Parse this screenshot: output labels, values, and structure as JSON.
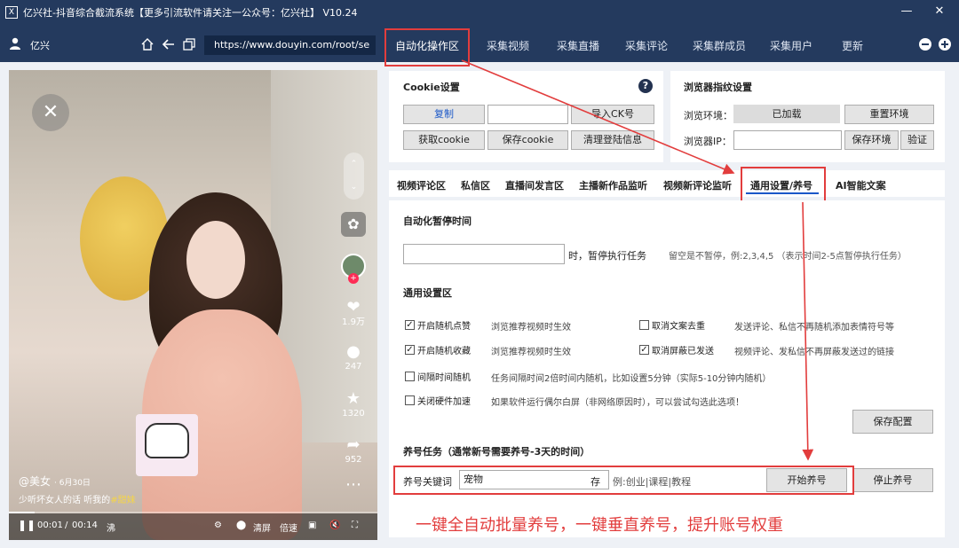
{
  "window": {
    "title": "亿兴社-抖音综合截流系统【更多引流软件请关注一公众号：亿兴社】 V10.24",
    "logo": "X",
    "min_icon": "minimize-icon",
    "close_icon": "close-icon"
  },
  "nav": {
    "username": "亿兴",
    "url": "https://www.douyin.com/root/se",
    "tabs": [
      "自动化操作区",
      "采集视频",
      "采集直播",
      "采集评论",
      "采集群成员",
      "采集用户",
      "更新"
    ],
    "active_tab": "自动化操作区"
  },
  "video": {
    "like_count": "1.9万",
    "comment_count": "247",
    "favorite_count": "1320",
    "share_count": "952",
    "author": "@美女",
    "date": "· 6月30日",
    "caption_prefix": "少听坏女人的话 听我的",
    "caption_tag": "#甜妹",
    "time_current": "00:01",
    "time_separator": "/",
    "time_total": "00:14",
    "control_labels": [
      "清屏",
      "倍速"
    ],
    "progress_fraction": 0.07,
    "bottom_glyph": "沸"
  },
  "cookie": {
    "title": "Cookie设置",
    "copy_label": "复制",
    "import_label": "导入CK号",
    "get_cookie_label": "获取cookie",
    "save_cookie_label": "保存cookie",
    "clear_login_label": "清理登陆信息"
  },
  "fingerprint": {
    "title": "浏览器指纹设置",
    "env_label": "浏览环境：",
    "env_status": "已加载",
    "reset_env_label": "重置环境",
    "ip_label": "浏览器IP：",
    "save_env_label": "保存环境",
    "verify_label": "验证"
  },
  "sub_tabs": {
    "items": [
      "视频评论区",
      "私信区",
      "直播间发言区",
      "主播新作品监听",
      "视频新评论监听",
      "通用设置/养号",
      "AI智能文案"
    ],
    "active": "通用设置/养号"
  },
  "pause": {
    "title": "自动化暂停时间",
    "suffix": "时，暂停执行任务",
    "hint": "留空是不暂停，例:2,3,4,5 （表示时间2-5点暂停执行任务）"
  },
  "general": {
    "title": "通用设置区",
    "options": [
      {
        "label": "开启随机点赞",
        "checked": true,
        "desc": "浏览推荐视频时生效"
      },
      {
        "label": "取消文案去重",
        "checked": false,
        "desc": "发送评论、私信不再随机添加表情符号等"
      },
      {
        "label": "开启随机收藏",
        "checked": true,
        "desc": "浏览推荐视频时生效"
      },
      {
        "label": "取消屏蔽已发送",
        "checked": true,
        "desc": "视频评论、发私信不再屏蔽发送过的链接"
      },
      {
        "label": "间隔时间随机",
        "checked": false,
        "desc": "任务间隔时间2倍时间内随机，比如设置5分钟（实际5-10分钟内随机）"
      },
      {
        "label": "关闭硬件加速",
        "checked": false,
        "desc": "如果软件运行偶尔白屏（非网络原因时），可以尝试勾选此选项！"
      }
    ],
    "save_label": "保存配置"
  },
  "nurture": {
    "title": "养号任务（通常新号需要养号-3天的时间）",
    "keyword_label": "养号关键词",
    "keyword_value": "宠物",
    "store_label": "存",
    "example": "例:创业|课程|教程",
    "start_label": "开始养号",
    "stop_label": "停止养号"
  },
  "promo_text": "一键全自动批量养号，一键垂直养号，提升账号权重",
  "colors": {
    "titlebar": "#243a5e",
    "annotation_red": "#e23d3d",
    "accent_blue": "#1a57c8"
  }
}
